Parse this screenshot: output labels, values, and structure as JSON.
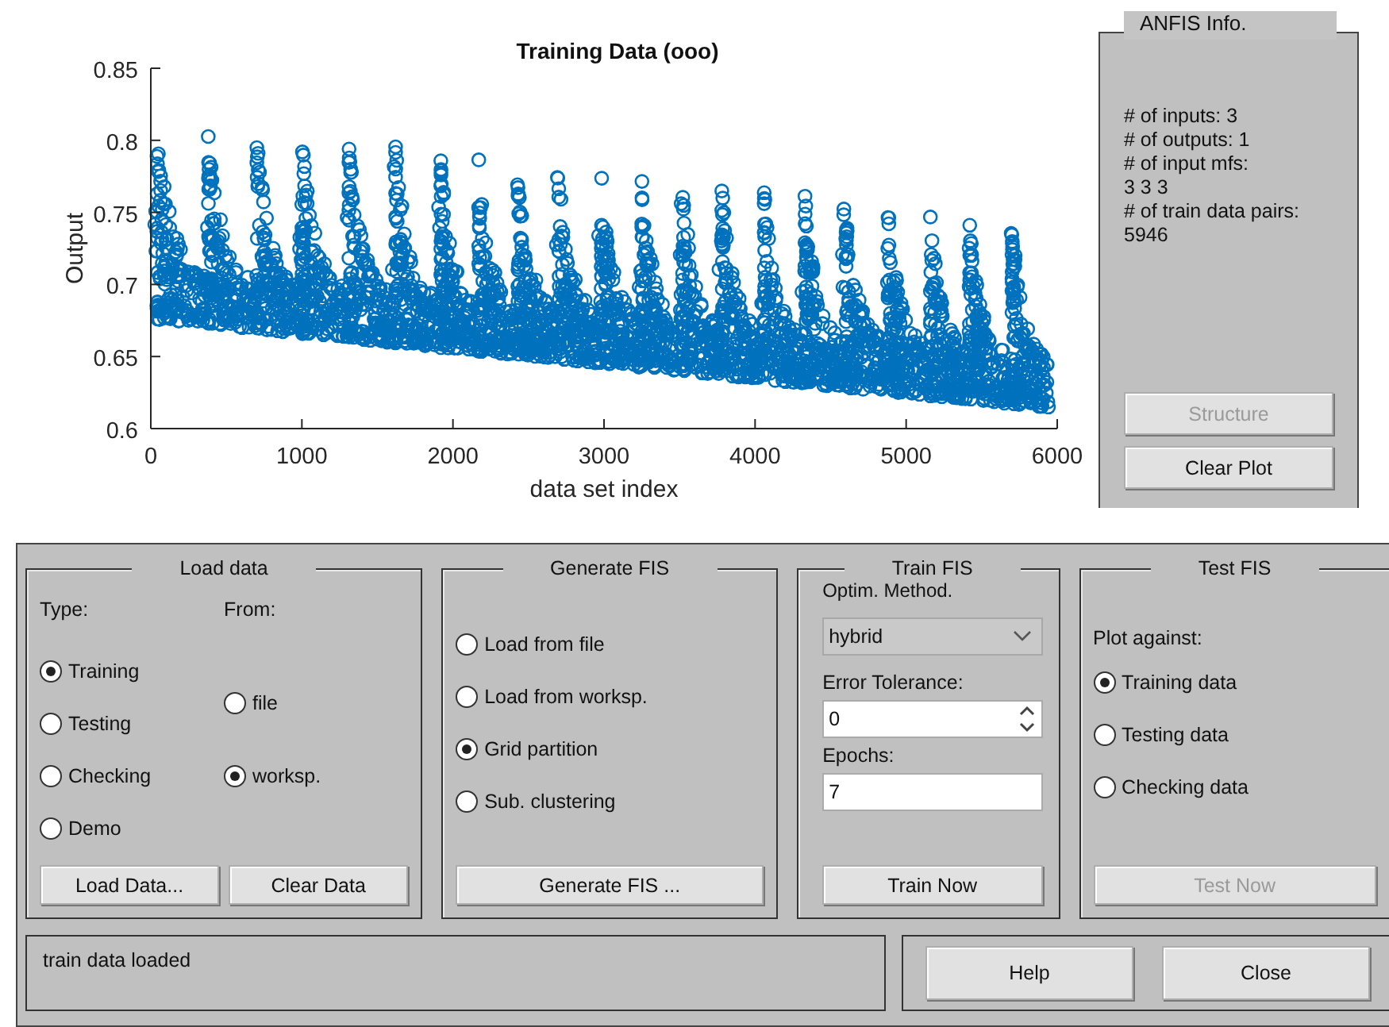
{
  "plot": {
    "title": "Training Data (ooo)",
    "xlabel": "data set index",
    "ylabel": "Output",
    "xticks": [
      "0",
      "1000",
      "2000",
      "3000",
      "4000",
      "5000",
      "6000"
    ],
    "yticks": [
      "0.85",
      "0.8",
      "0.75",
      "0.7",
      "0.65",
      "0.6"
    ]
  },
  "info": {
    "title": "ANFIS Info.",
    "lines": [
      "# of inputs: 3",
      "# of outputs: 1",
      "# of input mfs:",
      "3  3  3",
      "# of train data pairs:",
      "5946"
    ],
    "buttons": [
      {
        "label": "Structure",
        "disabled": true
      },
      {
        "label": "Clear Plot",
        "disabled": false
      }
    ]
  },
  "load_data": {
    "title": "Load data",
    "type_label": "Type:",
    "from_label": "From:",
    "type_options": [
      {
        "label": "Training",
        "selected": true
      },
      {
        "label": "Testing",
        "selected": false
      },
      {
        "label": "Checking",
        "selected": false
      },
      {
        "label": "Demo",
        "selected": false
      }
    ],
    "from_options": [
      {
        "label": "file",
        "selected": false
      },
      {
        "label": "worksp.",
        "selected": true
      }
    ],
    "buttons": [
      {
        "label": "Load Data...",
        "disabled": false
      },
      {
        "label": "Clear Data",
        "disabled": false
      }
    ]
  },
  "generate_fis": {
    "title": "Generate FIS",
    "options": [
      {
        "label": "Load from file",
        "selected": false
      },
      {
        "label": "Load from worksp.",
        "selected": false
      },
      {
        "label": "Grid partition",
        "selected": true
      },
      {
        "label": "Sub. clustering",
        "selected": false
      }
    ],
    "button": {
      "label": "Generate FIS ...",
      "disabled": false
    }
  },
  "train_fis": {
    "title": "Train FIS",
    "method_label": "Optim. Method.",
    "method_value": "hybrid",
    "tolerance_label": "Error Tolerance:",
    "tolerance_value": "0",
    "epochs_label": "Epochs:",
    "epochs_value": "7",
    "button": {
      "label": "Train Now",
      "disabled": false
    }
  },
  "test_fis": {
    "title": "Test FIS",
    "plot_label": "Plot against:",
    "options": [
      {
        "label": "Training data",
        "selected": true
      },
      {
        "label": "Testing data",
        "selected": false
      },
      {
        "label": "Checking data",
        "selected": false
      }
    ],
    "button": {
      "label": "Test Now",
      "disabled": true
    }
  },
  "status": "train data loaded",
  "buttons": [
    {
      "label": "Help",
      "disabled": false
    },
    {
      "label": "Close",
      "disabled": false
    }
  ]
}
